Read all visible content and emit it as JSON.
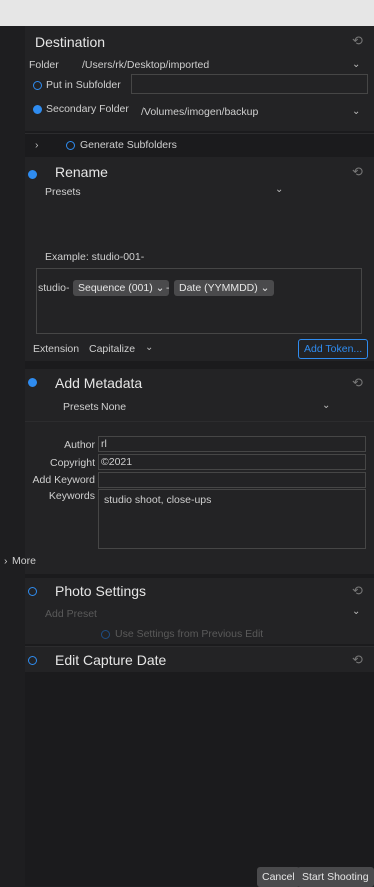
{
  "destination": {
    "title": "Destination",
    "folder_label": "Folder",
    "folder_value": "/Users/rk/Desktop/imported",
    "put_in_subfolder_label": "Put in Subfolder",
    "put_in_subfolder_value": "",
    "secondary_folder_label": "Secondary Folder",
    "secondary_folder_value": "/Volumes/imogen/backup",
    "generate_subfolders_label": "Generate Subfolders"
  },
  "rename": {
    "title": "Rename",
    "presets_label": "Presets",
    "example_label": "Example: studio-001-",
    "template_prefix": "studio-",
    "token_sequence": "Sequence (001)",
    "separator": "-",
    "token_date": "Date (YYMMDD)",
    "extension_label": "Extension",
    "extension_value": "Capitalize",
    "add_token_label": "Add Token..."
  },
  "metadata": {
    "title": "Add Metadata",
    "presets_label": "Presets",
    "presets_value": "None",
    "author_label": "Author",
    "author_value": "rl",
    "copyright_label": "Copyright",
    "copyright_value": "©2021",
    "add_keyword_label": "Add Keyword",
    "add_keyword_value": "",
    "keywords_label": "Keywords",
    "keywords_value": "studio shoot, close-ups",
    "more_label": "More"
  },
  "photo_settings": {
    "title": "Photo Settings",
    "add_preset_label": "Add Preset",
    "use_previous_label": "Use Settings from Previous Edit"
  },
  "capture_date": {
    "title": "Edit Capture Date"
  },
  "footer": {
    "cancel_label": "Cancel",
    "start_label": "Start Shooting"
  },
  "icons": {
    "reset": "reset-icon",
    "chevron": "chevron-down-icon"
  },
  "colors": {
    "accent": "#2f8cf0",
    "panel": "#1b1b1d",
    "section": "#232325"
  }
}
